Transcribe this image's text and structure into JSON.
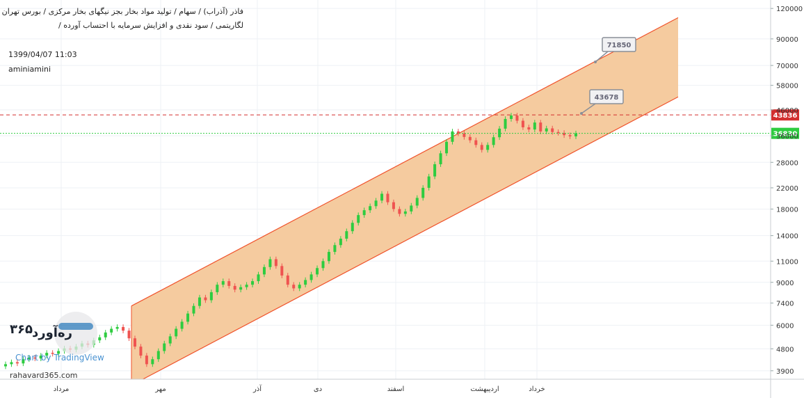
{
  "header": {
    "line1": "فاذر (آذراب) / سهام / تولید مواد بخار بجز نیگهای بخار مرکزی / بورس تهران",
    "line2": "لگاریتمی / سود نقدی و افزایش سرمایه با احتساب آورده /",
    "timestamp": "1399/04/07 11:03",
    "author": "aminiamini"
  },
  "watermark": {
    "brand": "ره‌آورد",
    "number": "۳۶۵",
    "site": "rahavard365.com",
    "tradingview": "Chart by TradingView"
  },
  "colors": {
    "up": "#26a69a",
    "up_bright": "#2ecc40",
    "down": "#ef5350",
    "channel_fill": "#f4c89a",
    "channel_line": "#f0522b",
    "resistance": "#d32f2f",
    "support": "#2ecc40",
    "grid": "#eef1f5"
  },
  "chart_data": {
    "type": "line",
    "title": "",
    "scale": "log",
    "ylim": [
      3600,
      130000
    ],
    "y_ticks": [
      3900,
      4800,
      6000,
      7400,
      9000,
      11000,
      14000,
      18000,
      22000,
      28000,
      36000,
      46000,
      58000,
      70000,
      90000,
      120000
    ],
    "x_categories": [
      "مرداد",
      "مهر",
      "آذر",
      "دی",
      "اسفند",
      "اردیبهشت",
      "خرداد"
    ],
    "grid": true,
    "series": [
      {
        "values": [
          4150,
          4230,
          4180,
          4350,
          4420,
          4380,
          4500,
          4620,
          4580,
          4700,
          4820,
          4760,
          4900,
          5050,
          4980,
          5200,
          5350,
          5600,
          5800,
          5900,
          5700,
          5300,
          4900,
          4500,
          4150,
          4350,
          4700,
          5050,
          5400,
          5800,
          6200,
          6700,
          7200,
          7800,
          7600,
          8200,
          8800,
          9100,
          8700,
          8400,
          8600,
          8800,
          9100,
          9700,
          10400,
          11200,
          10500,
          9600,
          8800,
          8500,
          8800,
          9200,
          9700,
          10300,
          11000,
          12000,
          12800,
          13600,
          14600,
          15800,
          17000,
          17800,
          18500,
          19500,
          20800,
          19200,
          18000,
          17200,
          17600,
          18600,
          20000,
          22000,
          24500,
          27500,
          30500,
          34000,
          37500,
          36800,
          35600,
          34500,
          33000,
          31500,
          33000,
          35500,
          38500,
          42200,
          43600,
          41500,
          39000,
          38200,
          40800,
          37500,
          38600,
          37300,
          37000,
          36200,
          35800,
          36830
        ]
      }
    ],
    "price_lines": [
      {
        "label": "43836",
        "value": 43836
      },
      {
        "label": "36830",
        "value": 36830
      }
    ],
    "annotations": [
      {
        "label": "71850",
        "value": 71850
      },
      {
        "label": "43678",
        "value": 43678
      }
    ],
    "channel": {
      "upper": [
        7200,
        110000
      ],
      "lower": [
        3400,
        52000
      ]
    }
  }
}
